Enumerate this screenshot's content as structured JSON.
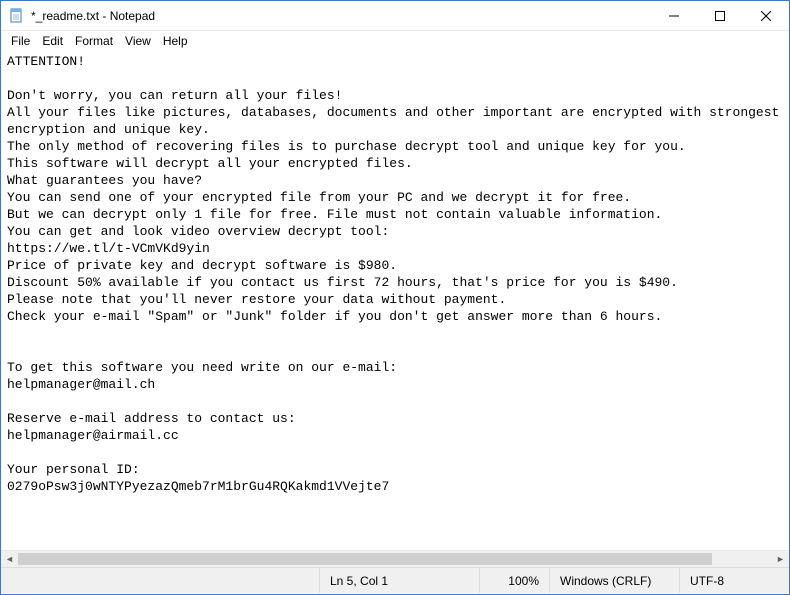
{
  "window": {
    "title": "*_readme.txt - Notepad"
  },
  "menu": {
    "file": "File",
    "edit": "Edit",
    "format": "Format",
    "view": "View",
    "help": "Help"
  },
  "document": {
    "text": "ATTENTION!\n\nDon't worry, you can return all your files!\nAll your files like pictures, databases, documents and other important are encrypted with strongest encryption and unique key.\nThe only method of recovering files is to purchase decrypt tool and unique key for you.\nThis software will decrypt all your encrypted files.\nWhat guarantees you have?\nYou can send one of your encrypted file from your PC and we decrypt it for free.\nBut we can decrypt only 1 file for free. File must not contain valuable information.\nYou can get and look video overview decrypt tool:\nhttps://we.tl/t-VCmVKd9yin\nPrice of private key and decrypt software is $980.\nDiscount 50% available if you contact us first 72 hours, that's price for you is $490.\nPlease note that you'll never restore your data without payment.\nCheck your e-mail \"Spam\" or \"Junk\" folder if you don't get answer more than 6 hours.\n\n\nTo get this software you need write on our e-mail:\nhelpmanager@mail.ch\n\nReserve e-mail address to contact us:\nhelpmanager@airmail.cc\n\nYour personal ID:\n0279oPsw3j0wNTYPyezazQmeb7rM1brGu4RQKakmd1VVejte7"
  },
  "status": {
    "lncol": "Ln 5, Col 1",
    "zoom": "100%",
    "eol": "Windows (CRLF)",
    "encoding": "UTF-8"
  }
}
